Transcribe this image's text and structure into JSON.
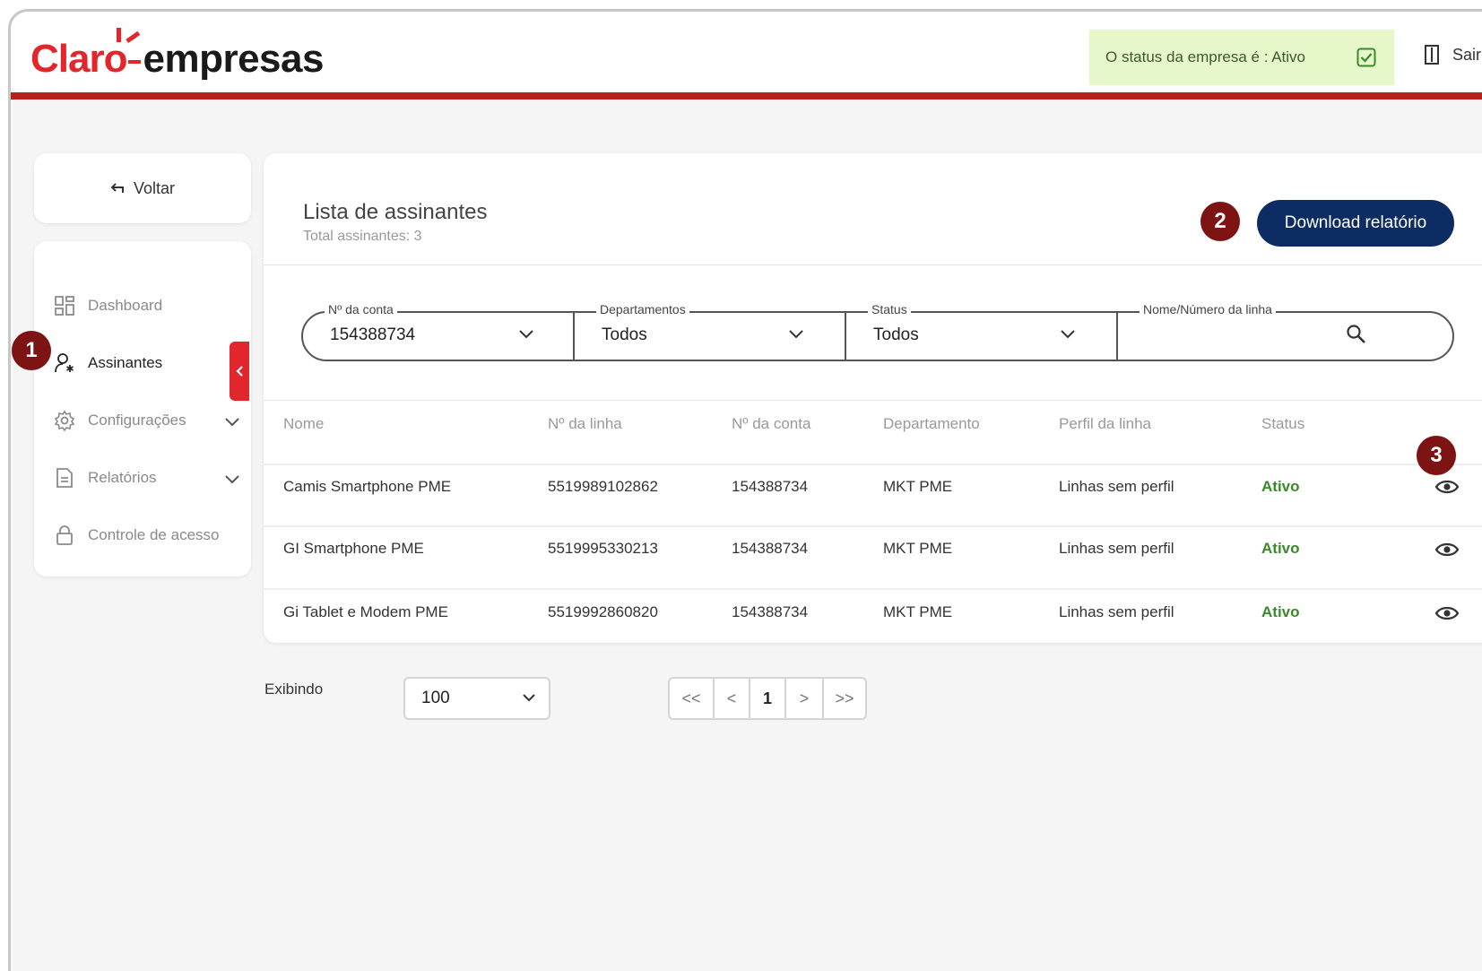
{
  "header": {
    "logo_brand": "Claro",
    "logo_product": "empresas",
    "company_status": "O status da empresa é : Ativo",
    "logout_label": "Sair"
  },
  "sidebar": {
    "back_label": "Voltar",
    "items": [
      {
        "label": "Dashboard",
        "icon": "dashboard-icon"
      },
      {
        "label": "Assinantes",
        "icon": "user-icon"
      },
      {
        "label": "Configurações",
        "icon": "gear-icon"
      },
      {
        "label": "Relatórios",
        "icon": "document-icon"
      },
      {
        "label": "Controle de acesso",
        "icon": "lock-icon"
      }
    ]
  },
  "main": {
    "title": "Lista de assinantes",
    "subtitle": "Total assinantes: 3",
    "download_label": "Download relatório",
    "filters": {
      "account": {
        "label": "Nº da conta",
        "value": "154388734"
      },
      "department": {
        "label": "Departamentos",
        "value": "Todos"
      },
      "status": {
        "label": "Status",
        "value": "Todos"
      },
      "search": {
        "label": "Nome/Número da linha",
        "value": ""
      }
    },
    "table": {
      "headers": [
        "Nome",
        "Nº da linha",
        "Nº da conta",
        "Departamento",
        "Perfil da linha",
        "Status"
      ],
      "rows": [
        [
          "Camis Smartphone PME",
          "5519989102862",
          "154388734",
          "MKT PME",
          "Linhas sem perfil",
          "Ativo"
        ],
        [
          "GI Smartphone PME",
          "5519995330213",
          "154388734",
          "MKT PME",
          "Linhas sem perfil",
          "Ativo"
        ],
        [
          "Gi Tablet e Modem PME",
          "5519992860820",
          "154388734",
          "MKT PME",
          "Linhas sem perfil",
          "Ativo"
        ]
      ]
    }
  },
  "footer": {
    "showing_label": "Exibindo",
    "page_size": "100",
    "pager": {
      "first": "<<",
      "prev": "<",
      "current": "1",
      "next": ">",
      "last": ">>"
    }
  },
  "annotations": [
    "1",
    "2",
    "3"
  ],
  "colors": {
    "brand_red": "#e3262b",
    "header_rule": "#b3241f",
    "primary_button": "#0c2c63",
    "status_green": "#3a8a2a",
    "status_pill_bg": "#e6f7c9",
    "badge": "#7d1313"
  }
}
